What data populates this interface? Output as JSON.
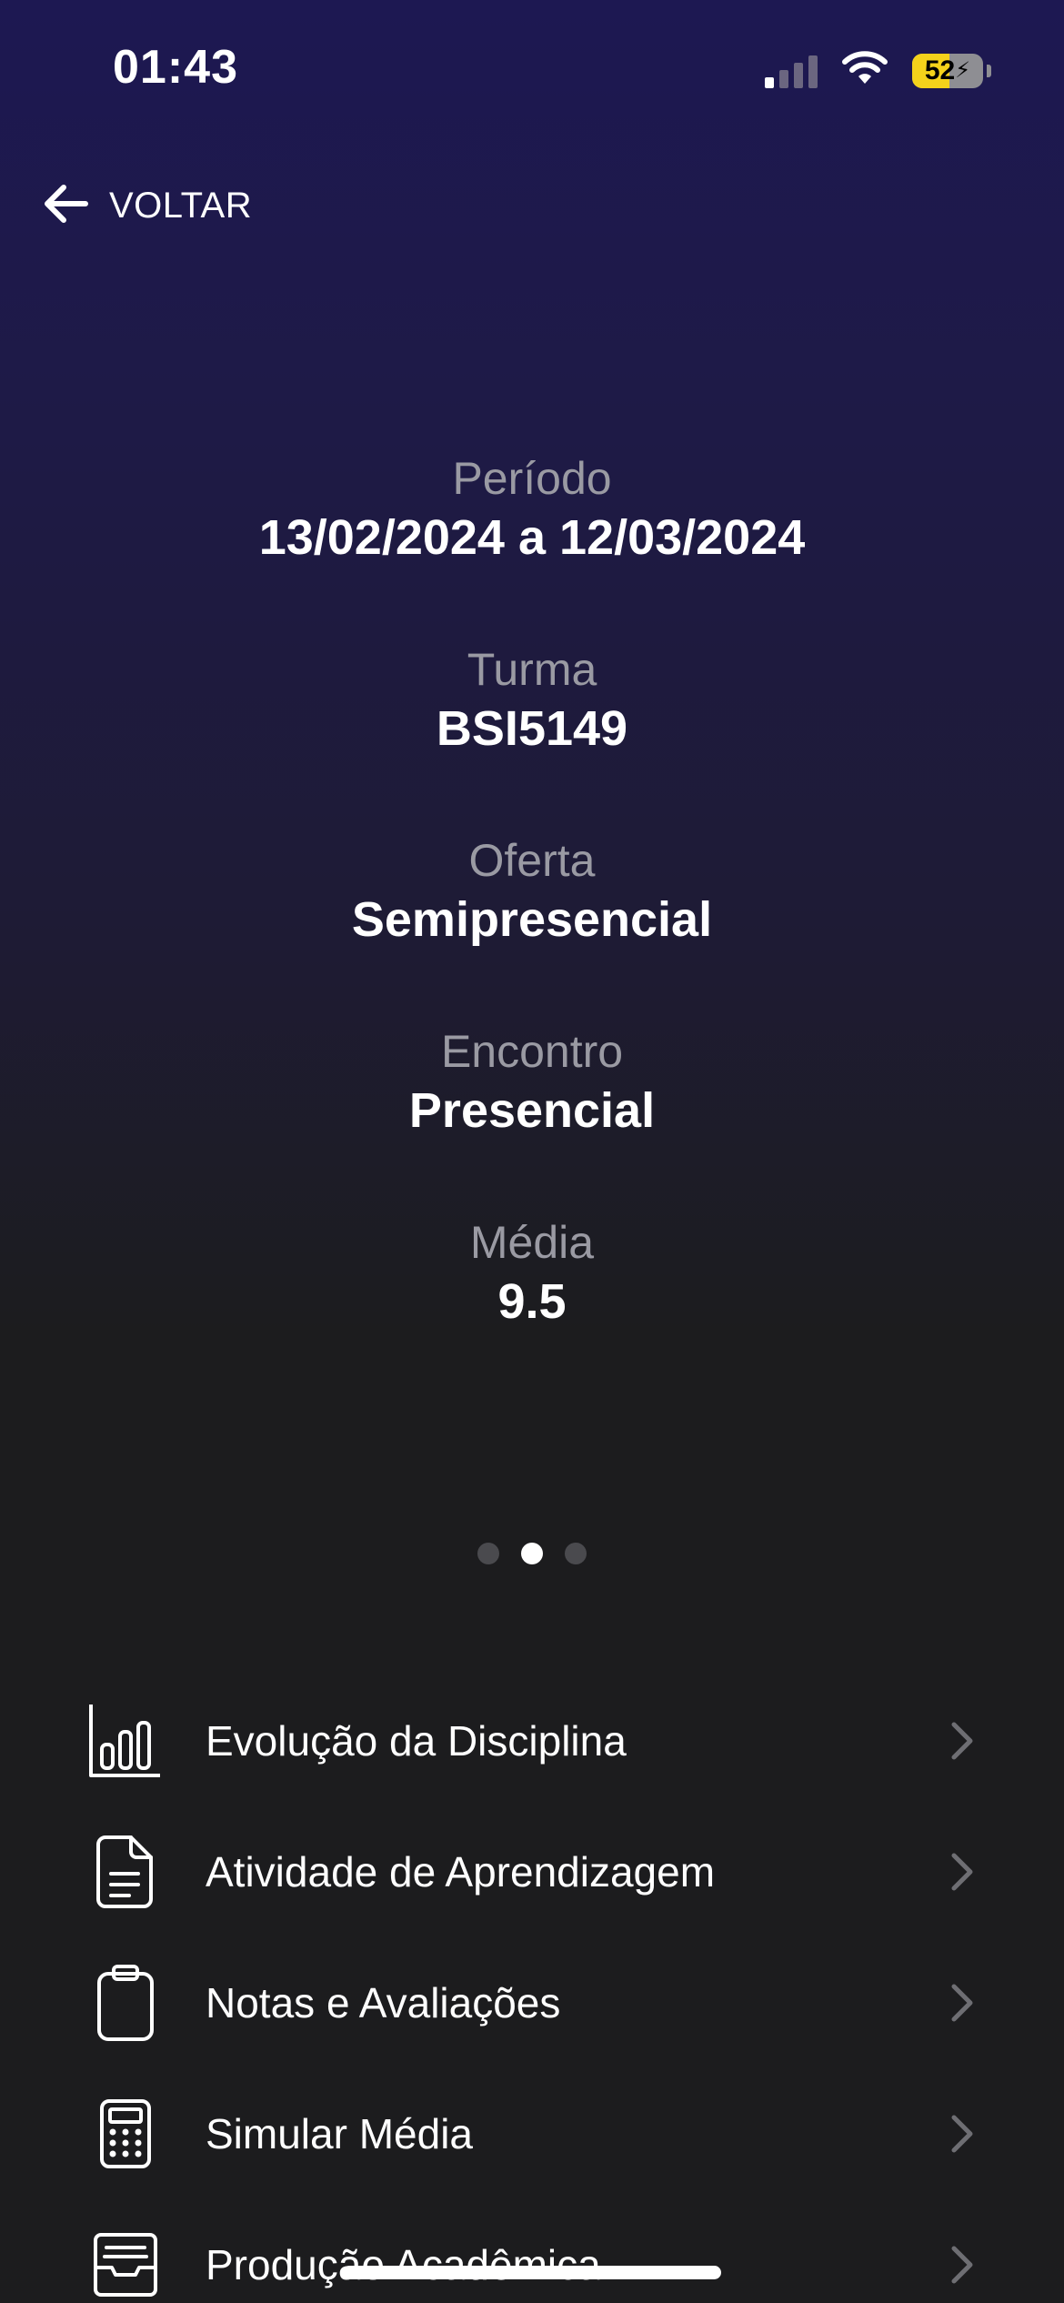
{
  "status_bar": {
    "time": "01:43",
    "battery_level": "52",
    "battery_percent_fill": 52,
    "signal_bars_active": 1,
    "signal_bars_total": 4,
    "charging": true
  },
  "nav": {
    "back_label": "VOLTAR",
    "back_icon": "arrow-left-icon"
  },
  "info": [
    {
      "label": "Período",
      "value": "13/02/2024 a 12/03/2024"
    },
    {
      "label": "Turma",
      "value": "BSI5149"
    },
    {
      "label": "Oferta",
      "value": "Semipresencial"
    },
    {
      "label": "Encontro",
      "value": "Presencial"
    },
    {
      "label": "Média",
      "value": "9.5"
    }
  ],
  "pager": {
    "total": 3,
    "active_index": 1
  },
  "menu": [
    {
      "label": "Evolução da Disciplina",
      "icon": "bar-chart-icon"
    },
    {
      "label": "Atividade de Aprendizagem",
      "icon": "document-icon"
    },
    {
      "label": "Notas e Avaliações",
      "icon": "clipboard-icon"
    },
    {
      "label": "Simular Média",
      "icon": "calculator-icon"
    },
    {
      "label": "Produção Acadêmica",
      "icon": "inbox-tray-icon"
    }
  ],
  "colors": {
    "gradient_top": "#1d1852",
    "background": "#1c1c1e",
    "label_gray": "#9a9aa3",
    "battery_yellow": "#f4d21b"
  }
}
